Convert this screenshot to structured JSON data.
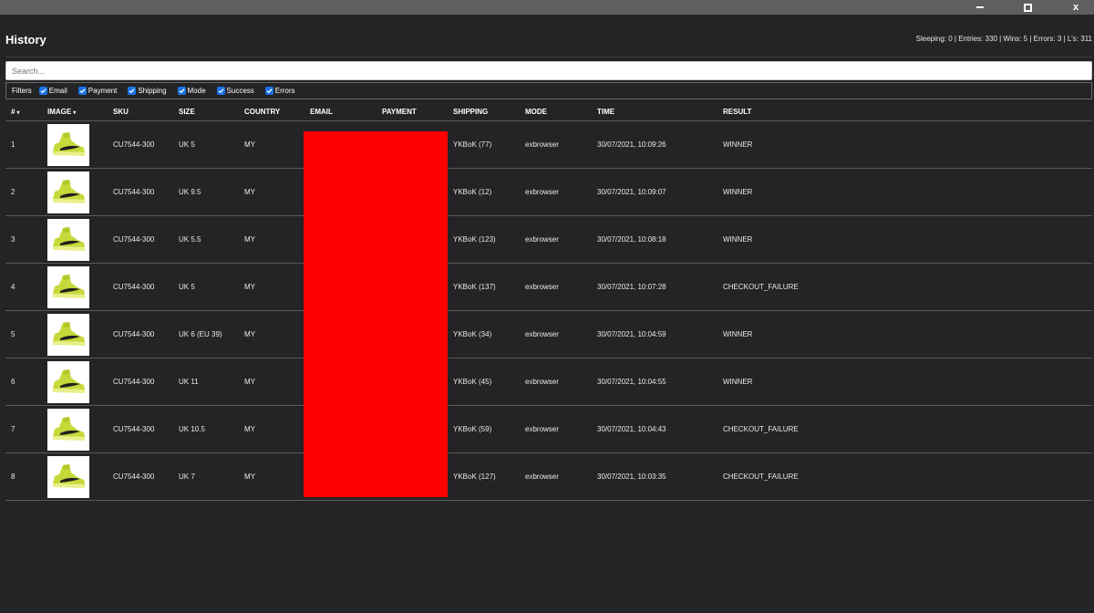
{
  "window": {
    "minimize_icon": "minimize-icon",
    "maximize_icon": "maximize-icon",
    "close_label": "x"
  },
  "page": {
    "title": "History",
    "stats": "Sleeping: 0 | Entries: 330 | Wins: 5 | Errors: 3 | L's: 311"
  },
  "search": {
    "placeholder": "Search...",
    "value": ""
  },
  "filters": {
    "label": "Filters",
    "items": [
      {
        "label": "Email",
        "checked": true
      },
      {
        "label": "Payment",
        "checked": true
      },
      {
        "label": "Shipping",
        "checked": true
      },
      {
        "label": "Mode",
        "checked": true
      },
      {
        "label": "Success",
        "checked": true
      },
      {
        "label": "Errors",
        "checked": true
      }
    ]
  },
  "table": {
    "columns": [
      "#",
      "IMAGE",
      "SKU",
      "SIZE",
      "COUNTRY",
      "EMAIL",
      "PAYMENT",
      "SHIPPING",
      "MODE",
      "TIME",
      "RESULT"
    ],
    "sort_indicator": "▾",
    "rows": [
      {
        "num": "1",
        "sku": "CU7544-300",
        "size": "UK 5",
        "country": "MY",
        "shipping": "YKBoK (77)",
        "mode": "exbrowser",
        "time": "30/07/2021, 10:09:26",
        "result": "WINNER"
      },
      {
        "num": "2",
        "sku": "CU7544-300",
        "size": "UK 9.5",
        "country": "MY",
        "shipping": "YKBoK (12)",
        "mode": "exbrowser",
        "time": "30/07/2021, 10:09:07",
        "result": "WINNER"
      },
      {
        "num": "3",
        "sku": "CU7544-300",
        "size": "UK 5.5",
        "country": "MY",
        "shipping": "YKBoK (123)",
        "mode": "exbrowser",
        "time": "30/07/2021, 10:08:18",
        "result": "WINNER"
      },
      {
        "num": "4",
        "sku": "CU7544-300",
        "size": "UK 5",
        "country": "MY",
        "shipping": "YKBoK (137)",
        "mode": "exbrowser",
        "time": "30/07/2021, 10:07:28",
        "result": "CHECKOUT_FAILURE"
      },
      {
        "num": "5",
        "sku": "CU7544-300",
        "size": "UK 6 (EU 39)",
        "country": "MY",
        "shipping": "YKBoK (34)",
        "mode": "exbrowser",
        "time": "30/07/2021, 10:04:59",
        "result": "WINNER"
      },
      {
        "num": "6",
        "sku": "CU7544-300",
        "size": "UK 11",
        "country": "MY",
        "shipping": "YKBoK (45)",
        "mode": "exbrowser",
        "time": "30/07/2021, 10:04:55",
        "result": "WINNER"
      },
      {
        "num": "7",
        "sku": "CU7544-300",
        "size": "UK 10.5",
        "country": "MY",
        "shipping": "YKBoK (59)",
        "mode": "exbrowser",
        "time": "30/07/2021, 10:04:43",
        "result": "CHECKOUT_FAILURE"
      },
      {
        "num": "8",
        "sku": "CU7544-300",
        "size": "UK 7",
        "country": "MY",
        "shipping": "YKBoK (127)",
        "mode": "exbrowser",
        "time": "30/07/2021, 10:03:35",
        "result": "CHECKOUT_FAILURE"
      }
    ]
  },
  "colors": {
    "background": "#242426",
    "titlebar": "#5f5f5f",
    "winner": "#6fcf6a",
    "failure": "#f29b17",
    "redaction": "#ff0000",
    "checkbox": "#1a73e8"
  },
  "icons": {
    "thumbnail": "sneaker-thumbnail",
    "checkbox": "checkbox-checked-icon"
  }
}
